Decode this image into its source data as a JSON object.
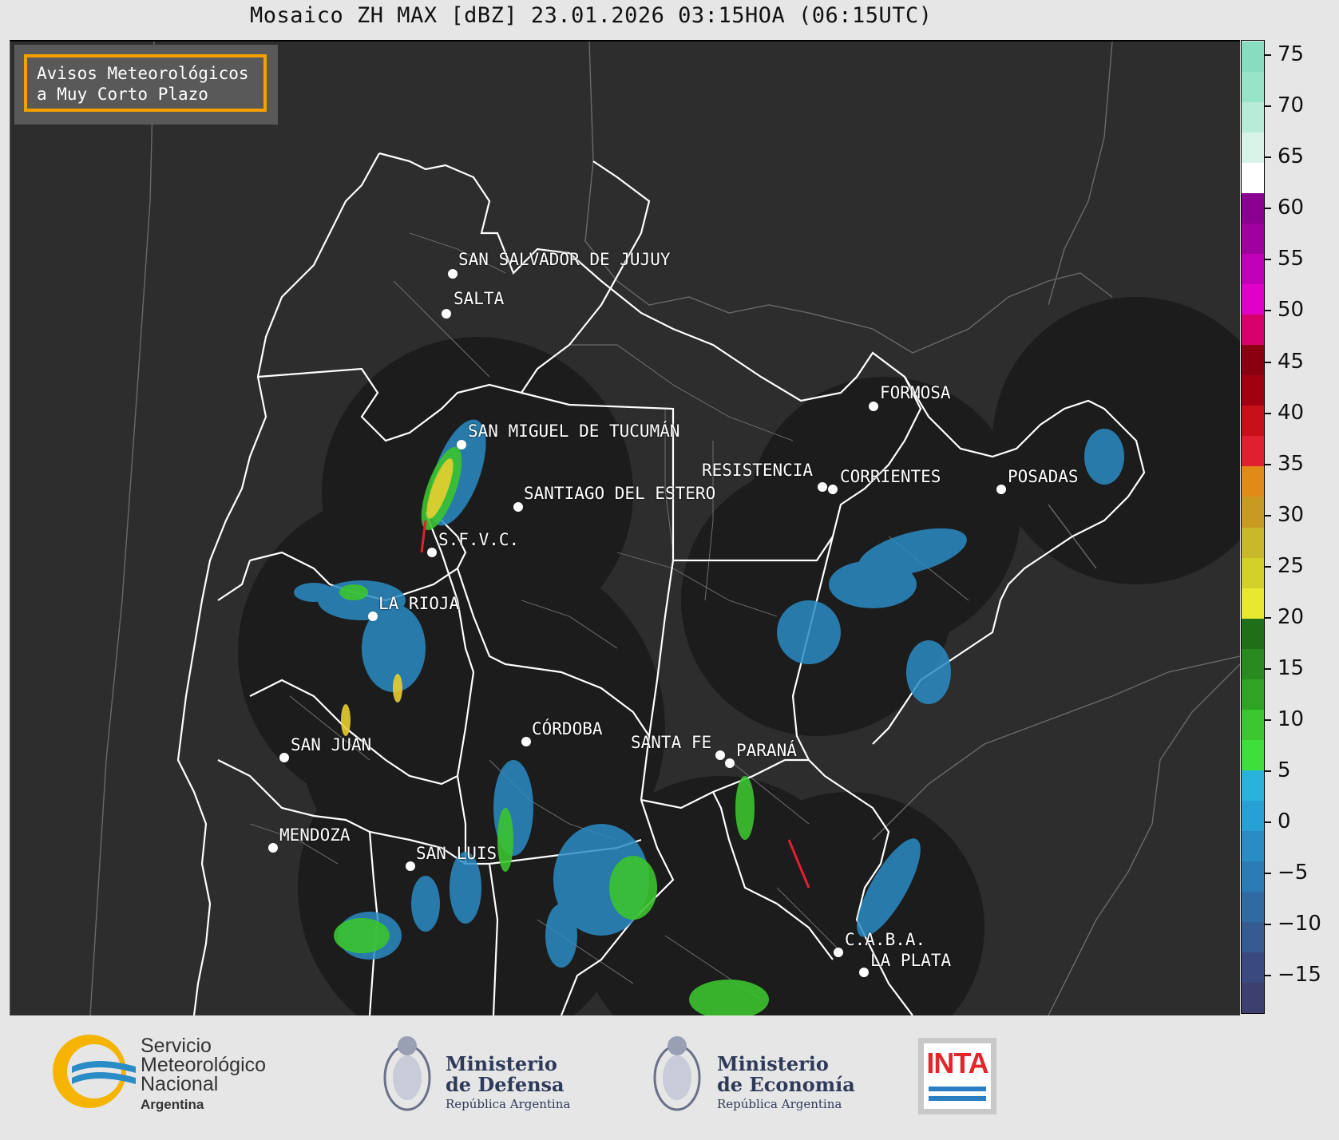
{
  "title": "Mosaico ZH MAX [dBZ] 23.01.2026 03:15HOA (06:15UTC)",
  "warning_box": {
    "line1": "Avisos Meteorológicos",
    "line2": "a Muy Corto Plazo",
    "border_color": "#f5a000"
  },
  "cities": [
    {
      "name": "SAN SALVADOR DE JUJUY"
    },
    {
      "name": "SALTA"
    },
    {
      "name": "FORMOSA"
    },
    {
      "name": "SAN MIGUEL DE TUCUMÁN"
    },
    {
      "name": "RESISTENCIA"
    },
    {
      "name": "CORRIENTES"
    },
    {
      "name": "POSADAS"
    },
    {
      "name": "SANTIAGO DEL ESTERO"
    },
    {
      "name": "S.F.V.C."
    },
    {
      "name": "LA RIOJA"
    },
    {
      "name": "CÓRDOBA"
    },
    {
      "name": "SANTA FE"
    },
    {
      "name": "PARANÁ"
    },
    {
      "name": "SAN JUAN"
    },
    {
      "name": "MENDOZA"
    },
    {
      "name": "SAN LUIS"
    },
    {
      "name": "C.A.B.A."
    },
    {
      "name": "LA PLATA"
    }
  ],
  "colorbar": {
    "unit": "dBZ",
    "ticks": [
      "75",
      "70",
      "65",
      "60",
      "55",
      "50",
      "45",
      "40",
      "35",
      "30",
      "25",
      "20",
      "15",
      "10",
      "5",
      "0",
      "−5",
      "−10",
      "−15"
    ],
    "min": -18.5,
    "max": 76.5,
    "colors": [
      "#3d3f6e",
      "#3a4a80",
      "#365a92",
      "#2f6aa3",
      "#2b7bb5",
      "#2a8cc5",
      "#27a0d6",
      "#28b3dc",
      "#3de03a",
      "#3ac72f",
      "#2fa324",
      "#288a1f",
      "#1f6e18",
      "#e8e830",
      "#d4d02a",
      "#c9b82a",
      "#c89a22",
      "#e08a18",
      "#e02030",
      "#c8101a",
      "#a00010",
      "#8a0010",
      "#d8006a",
      "#e000c8",
      "#c000b8",
      "#a000a0",
      "#8a0090",
      "#ffffff",
      "#d8f4e8",
      "#b8ecd8",
      "#98e4c8",
      "#88dcc0"
    ]
  },
  "logos": {
    "smn": {
      "line1": "Servicio",
      "line2": "Meteorológico",
      "line3": "Nacional",
      "line4": "Argentina"
    },
    "defensa": {
      "line1": "Ministerio",
      "line2": "de Defensa",
      "line3": "República Argentina"
    },
    "economia": {
      "line1": "Ministerio",
      "line2": "de Economía",
      "line3": "República Argentina"
    },
    "inta": {
      "text": "INTA"
    }
  }
}
